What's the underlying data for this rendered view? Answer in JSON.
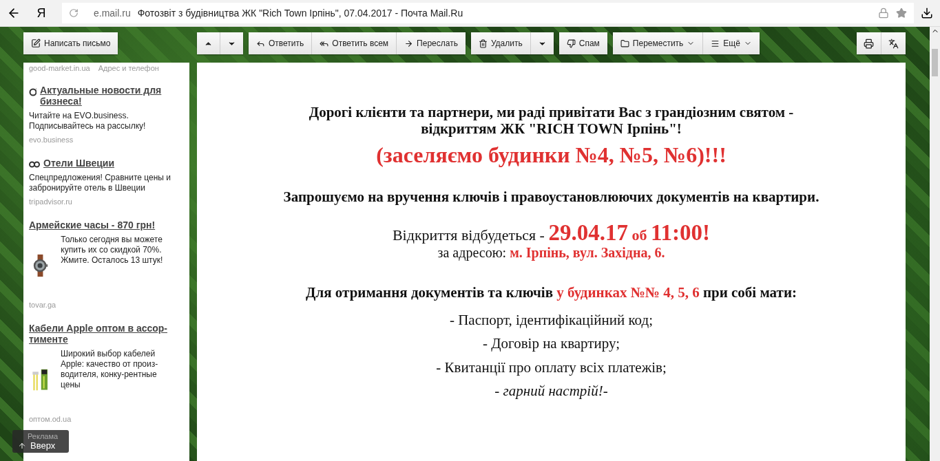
{
  "browser": {
    "host": "e.mail.ru",
    "title": "Фотозвіт з будівництва ЖК \"Rich Town Ірпінь\", 07.04.2017 - Почта Mail.Ru",
    "logo": "Я"
  },
  "toolbar": {
    "compose": "Написать письмо",
    "groups": [
      {
        "items": [
          {
            "kind": "up"
          },
          {
            "kind": "down"
          }
        ]
      },
      {
        "items": [
          {
            "kind": "reply",
            "label": "Ответить"
          },
          {
            "kind": "replyall",
            "label": "Ответить всем"
          },
          {
            "kind": "forward",
            "label": "Переслать"
          }
        ]
      },
      {
        "items": [
          {
            "kind": "trash",
            "label": "Удалить"
          },
          {
            "kind": "down"
          }
        ]
      },
      {
        "items": [
          {
            "kind": "spam",
            "label": "Спам"
          }
        ]
      },
      {
        "items": [
          {
            "kind": "folder",
            "label": "Переместить"
          },
          {
            "kind": "more",
            "label": "Ещё"
          }
        ]
      }
    ],
    "right": [
      {
        "kind": "print"
      },
      {
        "kind": "translate"
      }
    ]
  },
  "ads": {
    "top": {
      "source": "good-market.in.ua",
      "extra": "Адрес и телефон"
    },
    "items": [
      {
        "kind": "news",
        "title": "Актуальные новости для бизнеса!",
        "body": "Читайте на EVO.business. Подписывайтесь на рассылку!",
        "source": "evo.business"
      },
      {
        "kind": "travel",
        "title": "Отели Швеции",
        "body": "Спецпредложения! Сравните цены и забронируйте отель в Швеции",
        "source": "tripadvisor.ru"
      },
      {
        "kind": "product",
        "title": "Армейские часы - 870 грн!",
        "body": "Только сегодня вы можете купить их со скидкой 70%. Жмите. Осталось 13 штук!",
        "source": "tovar.ga"
      },
      {
        "kind": "product",
        "title": "Кабели Apple оптом в ассор-тименте",
        "body": "Широкий выбор кабелей Apple: качество от произ-водителя, конку-рентные цены",
        "source": "оптом.od.ua"
      }
    ],
    "label": "Реклама",
    "up": "Вверх"
  },
  "email": {
    "paragraphs": [
      {
        "kind": "heading",
        "segments": [
          {
            "text": "Дорогі клієнти та партнери, ми раді привітати Вас з грандіозним святом - відкриттям ЖК  \"RICH  TOWN  Ірпінь\"!",
            "kind": "plain"
          }
        ]
      },
      {
        "kind": "big",
        "segments": [
          {
            "text": "(заселяємо будинки №4, №5, №6)!!!",
            "kind": "accent"
          }
        ]
      },
      {
        "kind": "heading",
        "segments": [
          {
            "text": "Запрошуємо на  вручення ключів і правоустановлюючих документів  на квартири.",
            "kind": "plain"
          }
        ]
      },
      {
        "kind": "date",
        "segments": [
          {
            "text": "Відкриття відбудеться - ",
            "kind": "plain"
          },
          {
            "text": "29.04.17",
            "kind": "accent-big"
          },
          {
            "text": " об ",
            "kind": "accent"
          },
          {
            "text": "11:00!",
            "kind": "accent-big"
          }
        ]
      },
      {
        "kind": "address",
        "segments": [
          {
            "text": "за адресою: ",
            "kind": "plain"
          },
          {
            "text": "м. Ірпінь, вул. Західна, 6.",
            "kind": "accent"
          }
        ]
      },
      {
        "kind": "heading",
        "segments": [
          {
            "text": "Для отримання документів та ключів ",
            "kind": "plain"
          },
          {
            "text": "у будинках №№ 4, 5, 6",
            "kind": "accent"
          },
          {
            "text": " при собі мати:",
            "kind": "plain"
          }
        ]
      },
      {
        "kind": "item",
        "segments": [
          {
            "text": "- Паспорт, ідентифікаційний код;",
            "kind": "plain"
          }
        ]
      },
      {
        "kind": "item",
        "segments": [
          {
            "text": "- Договір на квартиру;",
            "kind": "plain"
          }
        ]
      },
      {
        "kind": "item",
        "segments": [
          {
            "text": "- Квитанції про оплату всіх платежів;",
            "kind": "plain"
          }
        ]
      },
      {
        "kind": "italic",
        "segments": [
          {
            "text": "- гарний настрій!-",
            "kind": "plain"
          }
        ]
      }
    ]
  }
}
